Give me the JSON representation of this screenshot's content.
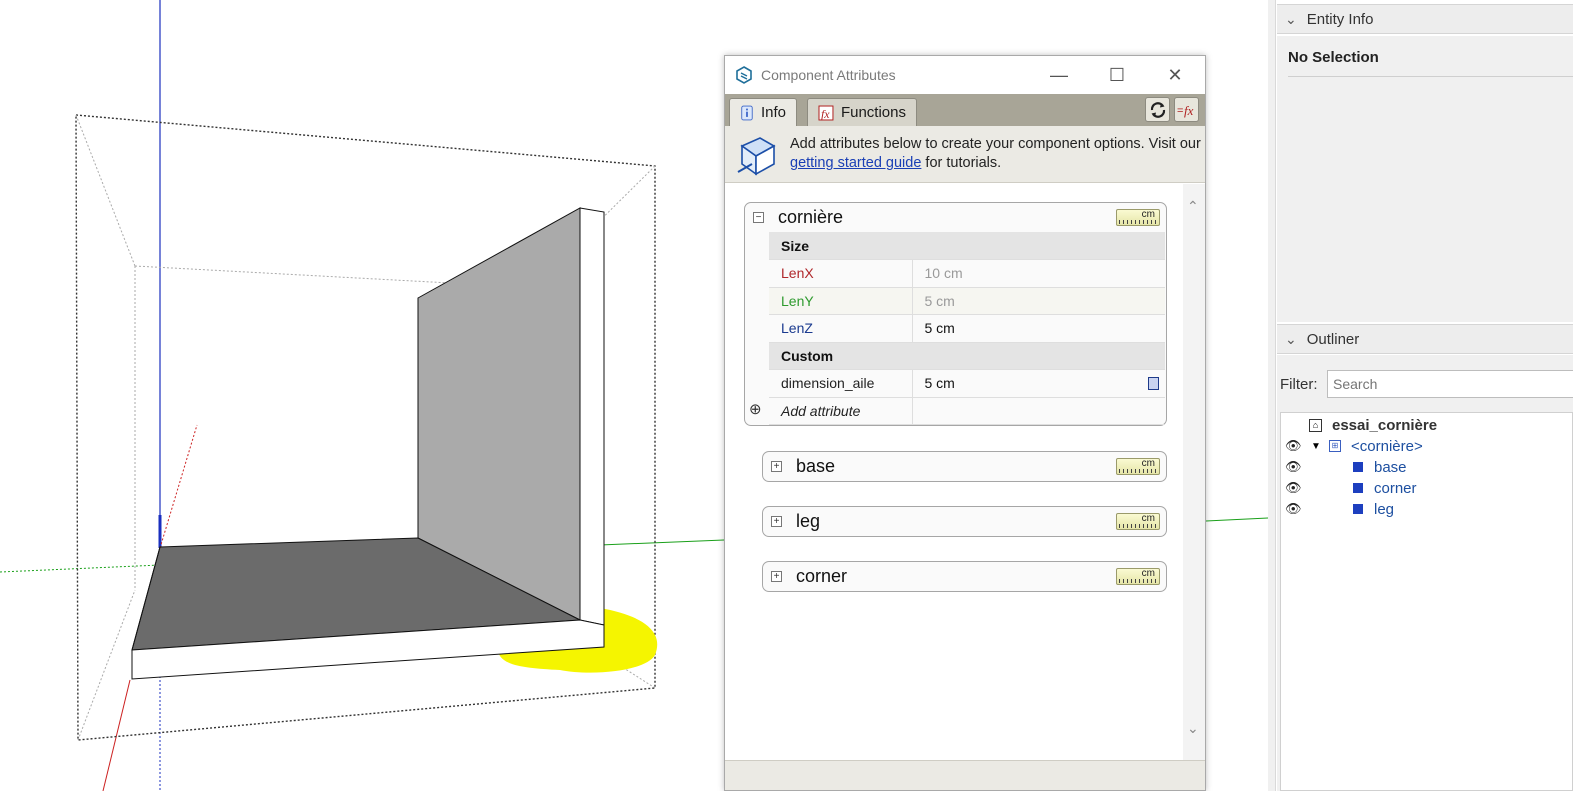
{
  "dialog": {
    "title": "Component Attributes",
    "tabs": [
      {
        "label": "Info",
        "active": true
      },
      {
        "label": "Functions",
        "active": false
      }
    ],
    "banner": {
      "text_before": "Add attributes below to create your component options. Visit our ",
      "link_text": "getting started guide",
      "text_after": " for tutorials."
    },
    "sections": [
      {
        "name": "cornière",
        "expanded": true,
        "unit": "cm",
        "groups": [
          {
            "label": "Size",
            "rows": [
              {
                "name": "LenX",
                "value": "10 cm",
                "color": "#b0282c",
                "readonly": true
              },
              {
                "name": "LenY",
                "value": "5 cm",
                "color": "#2e9a2e",
                "readonly": true
              },
              {
                "name": "LenZ",
                "value": "5 cm",
                "color": "#1a3a8f",
                "readonly": false
              }
            ]
          },
          {
            "label": "Custom",
            "rows": [
              {
                "name": "dimension_aile",
                "value": "5 cm",
                "color": "#222222",
                "readonly": false
              }
            ]
          }
        ],
        "add_label": "Add attribute"
      },
      {
        "name": "base",
        "expanded": false,
        "unit": "cm"
      },
      {
        "name": "leg",
        "expanded": false,
        "unit": "cm"
      },
      {
        "name": "corner",
        "expanded": false,
        "unit": "cm"
      }
    ]
  },
  "entity_info": {
    "title": "Entity Info",
    "status": "No Selection"
  },
  "outliner": {
    "title": "Outliner",
    "filter_label": "Filter:",
    "search_placeholder": "Search",
    "tree": [
      {
        "label": "essai_cornière",
        "level": 0,
        "type": "model"
      },
      {
        "label": "<cornière>",
        "level": 1,
        "type": "component"
      },
      {
        "label": "base",
        "level": 2,
        "type": "group"
      },
      {
        "label": "corner",
        "level": 2,
        "type": "group"
      },
      {
        "label": "leg",
        "level": 2,
        "type": "group"
      }
    ]
  },
  "colors": {
    "axis_blue": "#1a2fbf",
    "axis_red": "#cc2020",
    "axis_green": "#1aa01a",
    "highlight_yellow": "#f5f500",
    "face_dark": "#6b6b6b",
    "face_light": "#aaaaaa"
  }
}
